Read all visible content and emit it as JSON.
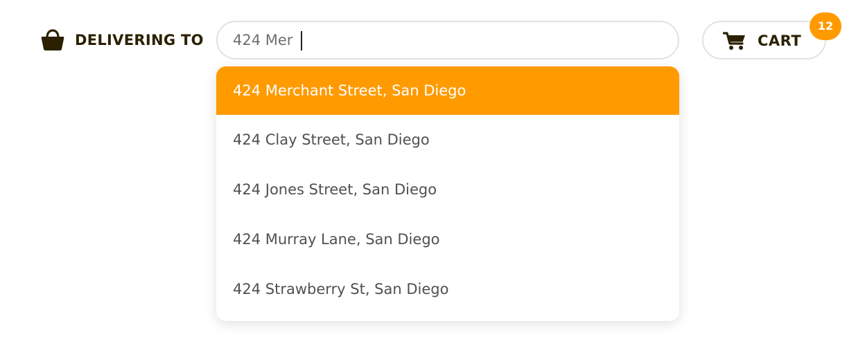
{
  "header": {
    "delivering_label": "DELIVERING TO",
    "bag_icon": "shopping-bag-icon"
  },
  "search": {
    "value": "424 Mer",
    "placeholder": ""
  },
  "cart": {
    "label": "CART",
    "count": "12",
    "icon": "cart-icon"
  },
  "suggestions": [
    {
      "label": "424 Merchant Street, San Diego",
      "selected": true
    },
    {
      "label": "424 Clay Street, San Diego",
      "selected": false
    },
    {
      "label": "424 Jones Street, San Diego",
      "selected": false
    },
    {
      "label": "424 Murray Lane, San Diego",
      "selected": false
    },
    {
      "label": "424 Strawberry St, San Diego",
      "selected": false
    }
  ],
  "colors": {
    "accent": "#ff9a00",
    "text_dark": "#2b2000",
    "text_muted": "#505050",
    "border": "#e2e2e2"
  }
}
